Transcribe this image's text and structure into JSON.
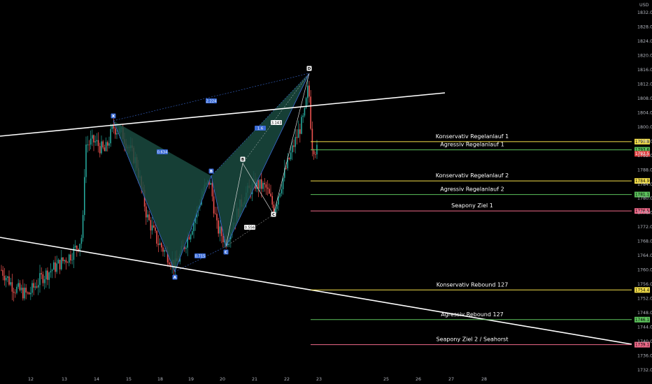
{
  "colors": {
    "background": "#000000",
    "candle_up": "#26a69a",
    "candle_down": "#ef5350",
    "pattern_fill": "#1a4a40",
    "pattern_line": "#3a6bd6",
    "trendline": "#ffffff",
    "conservative": "#f5e04a",
    "aggressive": "#5cc25c",
    "seapony": "#f06a8a",
    "current_price": "#e04040"
  },
  "chart_data": {
    "type": "candlestick",
    "currency": "USD",
    "x_ticks": [
      "12",
      "13",
      "14",
      "15",
      "18",
      "19",
      "20",
      "21",
      "22",
      "23",
      "25",
      "26",
      "27",
      "28"
    ],
    "y_ticks": [
      "1732.0",
      "1736.0",
      "1740.0",
      "1744.0",
      "1748.0",
      "1752.0",
      "1756.0",
      "1760.0",
      "1764.0",
      "1768.0",
      "1772.0",
      "1776.0",
      "1780.0",
      "1784.0",
      "1788.0",
      "1792.0",
      "1796.0",
      "1800.0",
      "1804.0",
      "1808.0",
      "1812.0",
      "1816.0",
      "1820.0",
      "1824.0",
      "1828.0",
      "1832.0"
    ],
    "ylim": [
      1730.0,
      1834.0
    ],
    "current_price": "1792.5",
    "levels": [
      {
        "label": "Konservativ Regelanlauf 1",
        "price": 1795.9,
        "tag": "1795.9",
        "color": "conservative"
      },
      {
        "label": "Agressiv Regelanlauf 1",
        "price": 1793.6,
        "tag": "1793.6",
        "color": "aggressive"
      },
      {
        "label": "Konservativ Regelanlauf 2",
        "price": 1784.9,
        "tag": "1784.9",
        "color": "conservative"
      },
      {
        "label": "Agressiv Regelanlauf 2",
        "price": 1781.1,
        "tag": "1781.1",
        "color": "aggressive"
      },
      {
        "label": "Seapony Ziel 1",
        "price": 1776.5,
        "tag": "1776.5",
        "color": "seapony"
      },
      {
        "label": "Konservativ Rebound 127",
        "price": 1754.4,
        "tag": "1754.4",
        "color": "conservative"
      },
      {
        "label": "Agressiv Rebound 127",
        "price": 1746.1,
        "tag": "1746.1",
        "color": "aggressive"
      },
      {
        "label": "Seapony Ziel 2 / Seahorst",
        "price": 1739.1,
        "tag": "1739.1",
        "color": "seapony"
      }
    ],
    "pattern_points": [
      {
        "label": "X",
        "day": "14",
        "price": 1801
      },
      {
        "label": "A",
        "day": "18",
        "price": 1761
      },
      {
        "label": "B",
        "day": "19",
        "price": 1785
      },
      {
        "label": "C",
        "day": "20",
        "price": 1767
      },
      {
        "label": "D",
        "day": "22",
        "price": 1814
      }
    ],
    "pattern_ratios": [
      "2.224",
      "0.634",
      "0.715",
      "1.6"
    ],
    "abcd_points": [
      "B",
      "C",
      "A"
    ],
    "abcd_ratios": [
      "3.143",
      "0.556"
    ],
    "ohlc_visible": false
  }
}
